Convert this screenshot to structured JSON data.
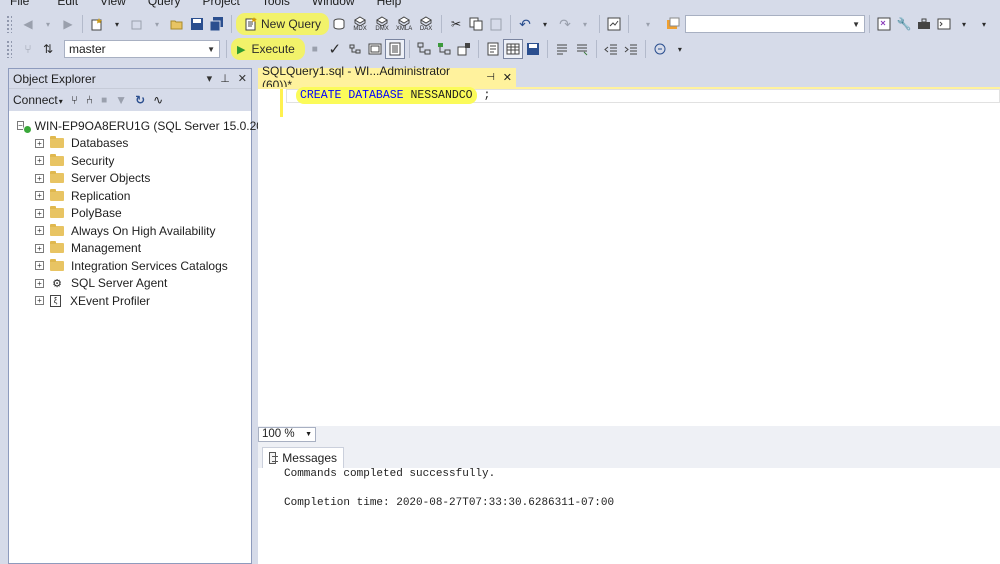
{
  "menu": [
    "File",
    "Edit",
    "View",
    "Query",
    "Project",
    "Tools",
    "Window",
    "Help"
  ],
  "toolbar1": {
    "new_query_label": "New Query",
    "xml_labels": [
      "MDX",
      "DMX",
      "XMLA",
      "DAX"
    ],
    "search_value": ""
  },
  "toolbar2": {
    "database": "master",
    "execute_label": "Execute"
  },
  "object_explorer": {
    "title": "Object Explorer",
    "connect_label": "Connect",
    "server": "WIN-EP9OA8ERU1G (SQL Server 15.0.20",
    "nodes": [
      {
        "label": "Databases",
        "icon": "folder-icon"
      },
      {
        "label": "Security",
        "icon": "folder-icon"
      },
      {
        "label": "Server Objects",
        "icon": "folder-icon"
      },
      {
        "label": "Replication",
        "icon": "folder-icon"
      },
      {
        "label": "PolyBase",
        "icon": "folder-icon"
      },
      {
        "label": "Always On High Availability",
        "icon": "folder-icon"
      },
      {
        "label": "Management",
        "icon": "folder-icon"
      },
      {
        "label": "Integration Services Catalogs",
        "icon": "folder-icon"
      },
      {
        "label": "SQL Server Agent",
        "icon": "agent-icon"
      },
      {
        "label": "XEvent Profiler",
        "icon": "xevent-icon"
      }
    ]
  },
  "editor": {
    "tab_title": "SQLQuery1.sql - WI...Administrator (60))*",
    "code": {
      "kw1": "CREATE",
      "kw2": "DATABASE",
      "name": "NESSANDCO",
      "terminator": ";"
    },
    "zoom": "100 %"
  },
  "results": {
    "tab_label": "Messages",
    "line1": "Commands completed successfully.",
    "line2": "Completion time: 2020-08-27T07:33:30.6286311-07:00"
  },
  "colors": {
    "highlight": "#f2f26a",
    "chrome": "#d6dbe9",
    "keyword": "#0000ff",
    "active_tab": "#fff29d"
  }
}
